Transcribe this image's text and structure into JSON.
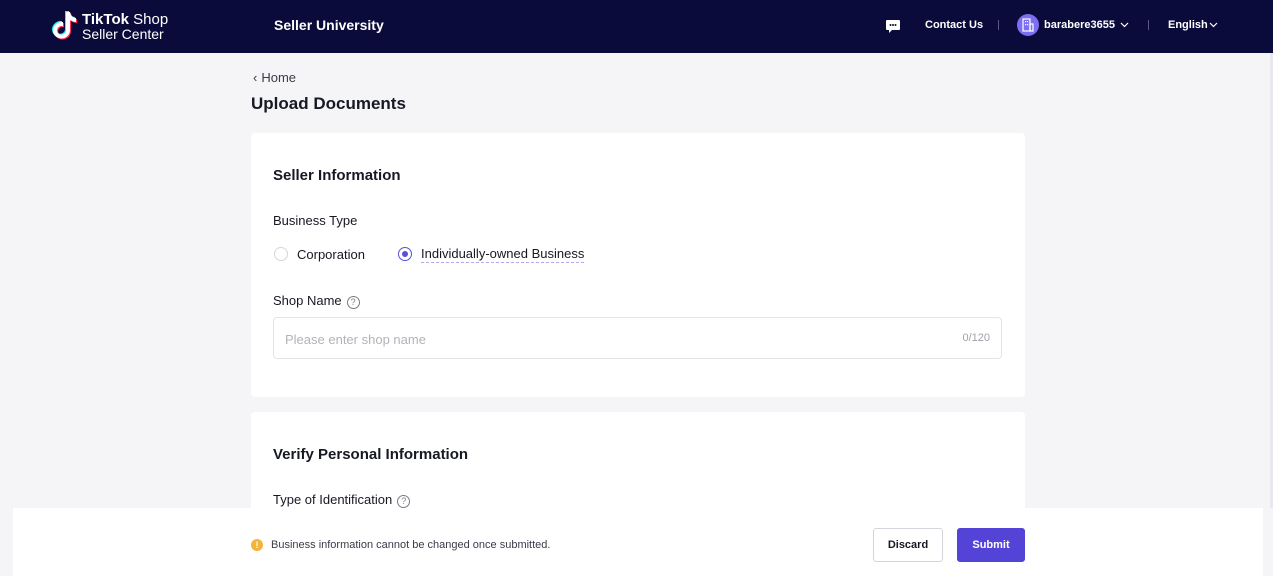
{
  "header": {
    "logo_line1_bold": "TikTok",
    "logo_line1_rest": " Shop",
    "logo_line2": "Seller Center",
    "nav_title": "Seller University",
    "contact_us": "Contact Us",
    "username": "barabere3655",
    "language": "English",
    "icons": [
      "tiktok-logo-icon",
      "chat-icon",
      "avatar-building-icon",
      "chevron-down-icon"
    ]
  },
  "breadcrumb": {
    "home": "Home"
  },
  "page": {
    "title": "Upload Documents"
  },
  "seller_info": {
    "title": "Seller Information",
    "business_type_label": "Business Type",
    "options": [
      {
        "label": "Corporation",
        "selected": false
      },
      {
        "label": "Individually-owned Business",
        "selected": true
      }
    ],
    "shop_name_label": "Shop Name",
    "shop_name_placeholder": "Please enter shop name",
    "shop_name_value": "",
    "shop_name_counter": "0/120"
  },
  "personal_info": {
    "title": "Verify Personal Information",
    "id_type_label": "Type of Identification"
  },
  "footer": {
    "warning": "Business information cannot be changed once submitted.",
    "discard": "Discard",
    "submit": "Submit"
  },
  "colors": {
    "header_bg": "#0b0b3b",
    "primary": "#5343d6",
    "warning": "#f3b43a",
    "page_bg": "#f5f5f8"
  }
}
